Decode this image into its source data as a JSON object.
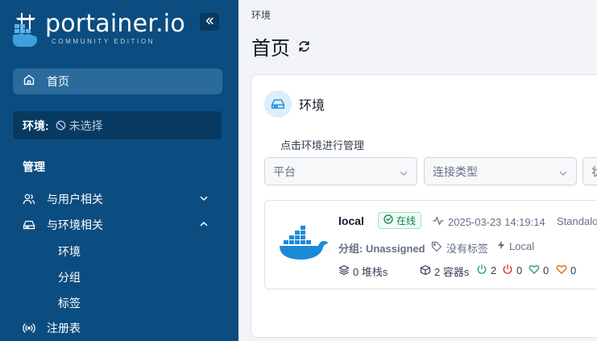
{
  "sidebar": {
    "logo": {
      "main": "portainer.io",
      "sub": "COMMUNITY EDITION"
    },
    "collapse_icon": "double-chevron-left-icon",
    "home": {
      "label": "首页",
      "icon": "home-icon"
    },
    "environment": {
      "key": "环境:",
      "value": "未选择",
      "icon": "ban-icon"
    },
    "section_title": "管理",
    "items": [
      {
        "label": "与用户相关",
        "icon": "users-icon",
        "expanded": false
      },
      {
        "label": "与环境相关",
        "icon": "drive-icon",
        "expanded": true,
        "children": [
          "环境",
          "分组",
          "标签"
        ]
      },
      {
        "label": "注册表",
        "icon": "broadcast-icon"
      }
    ]
  },
  "main": {
    "breadcrumb": "环境",
    "title": "首页",
    "refresh_icon": "refresh-icon",
    "card": {
      "title": "环境",
      "hint": "点击环境进行管理",
      "filters": [
        "平台",
        "连接类型",
        "状"
      ],
      "environment": {
        "name": "local",
        "status": "在线",
        "timestamp": "2025-03-23 14:19:14",
        "type": "Standalo",
        "group": "分组: Unassigned",
        "tags": "没有标签",
        "location": "Local",
        "stacks": "0 堆栈s",
        "containers": "2 容器s",
        "running": "2",
        "stopped": "0",
        "healthy": "0",
        "unhealthy": "0"
      }
    }
  },
  "colors": {
    "sidebar_bg": "#0b4d80",
    "sidebar_active": "#2a6b9c",
    "accent": "#1d8ad8",
    "online": "#18794e",
    "running": "#22a06b",
    "stopped": "#d92d20"
  }
}
